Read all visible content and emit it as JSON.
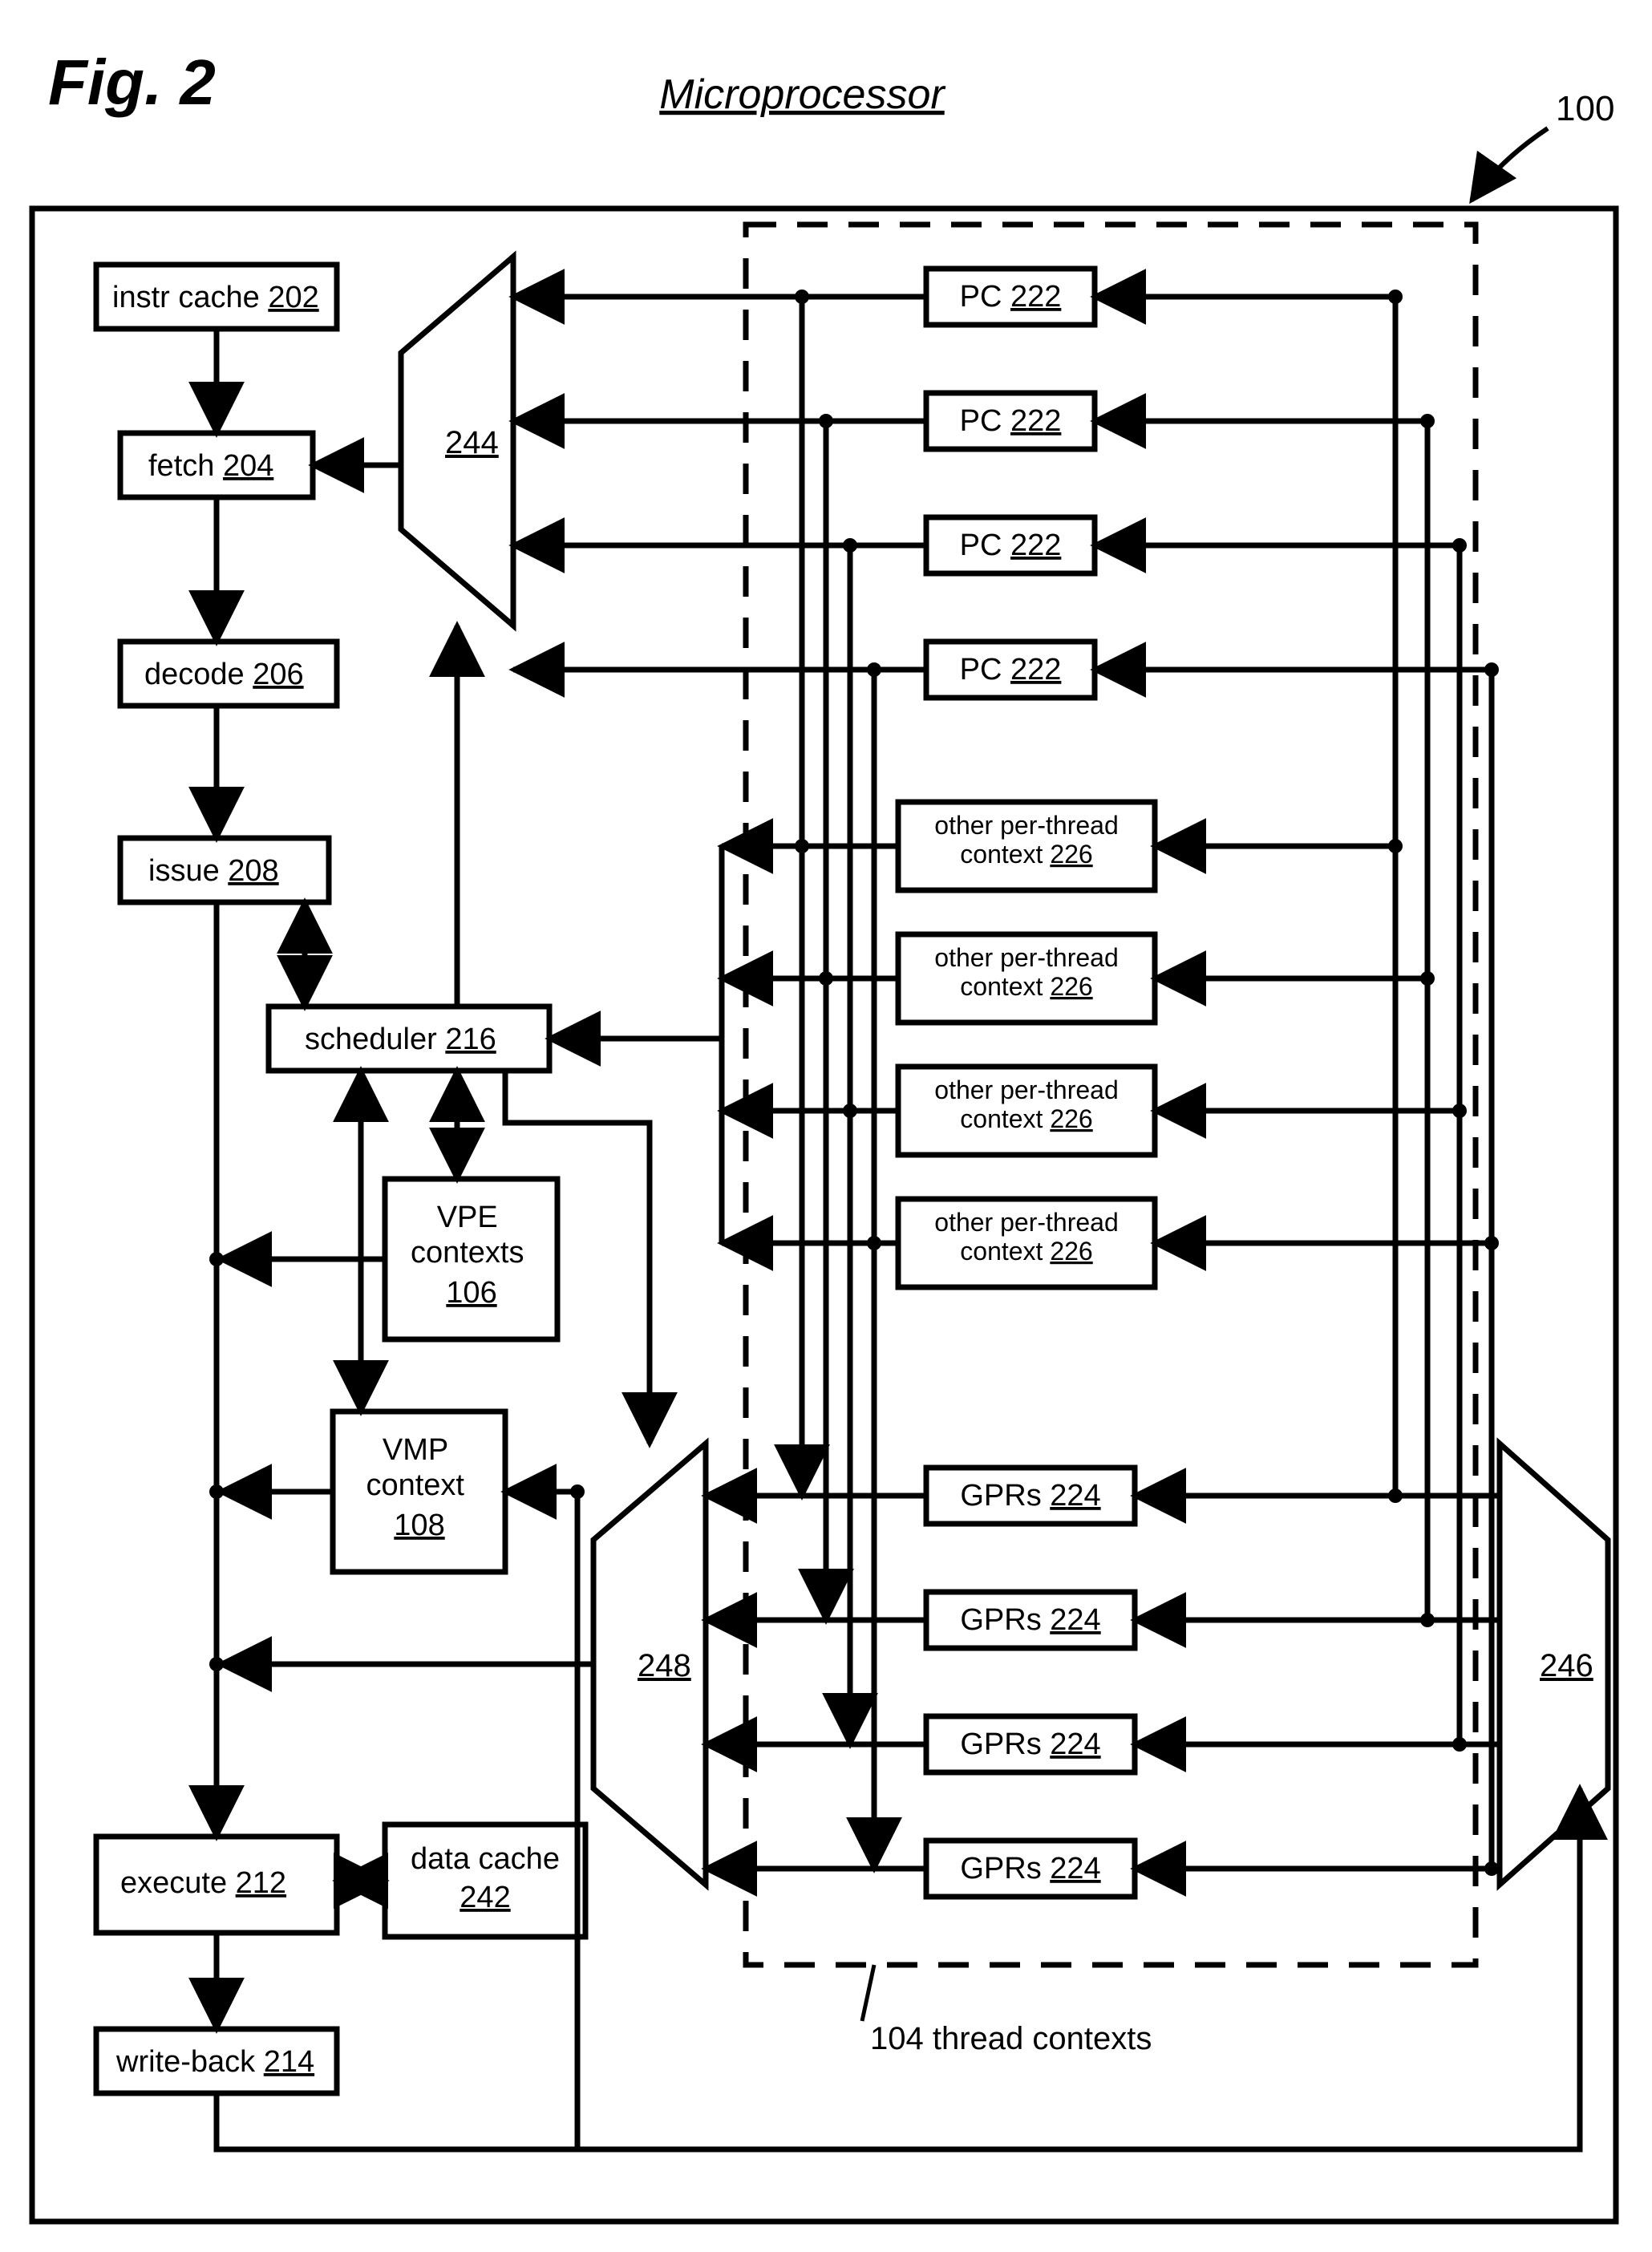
{
  "figure_label": "Fig. 2",
  "title": "Microprocessor",
  "ref_main": "100",
  "thread_contexts_label": "104  thread contexts",
  "blocks": {
    "instr_cache": {
      "label": "instr cache",
      "num": "202"
    },
    "fetch": {
      "label": "fetch",
      "num": "204"
    },
    "decode": {
      "label": "decode",
      "num": "206"
    },
    "issue": {
      "label": "issue",
      "num": "208"
    },
    "scheduler": {
      "label": "scheduler",
      "num": "216"
    },
    "vpe": {
      "label": "VPE\ncontexts",
      "num": "106"
    },
    "vmp": {
      "label": "VMP\ncontext",
      "num": "108"
    },
    "execute": {
      "label": "execute",
      "num": "212"
    },
    "data_cache": {
      "label": "data cache",
      "num": "242"
    },
    "write_back": {
      "label": "write-back",
      "num": "214"
    }
  },
  "mux": {
    "m244": "244",
    "m248": "248",
    "m246": "246"
  },
  "pc": {
    "label": "PC",
    "num": "222",
    "count": 4
  },
  "ctx": {
    "label": "other per-thread\ncontext",
    "num": "226",
    "count": 4
  },
  "gpr": {
    "label": "GPRs",
    "num": "224",
    "count": 4
  }
}
